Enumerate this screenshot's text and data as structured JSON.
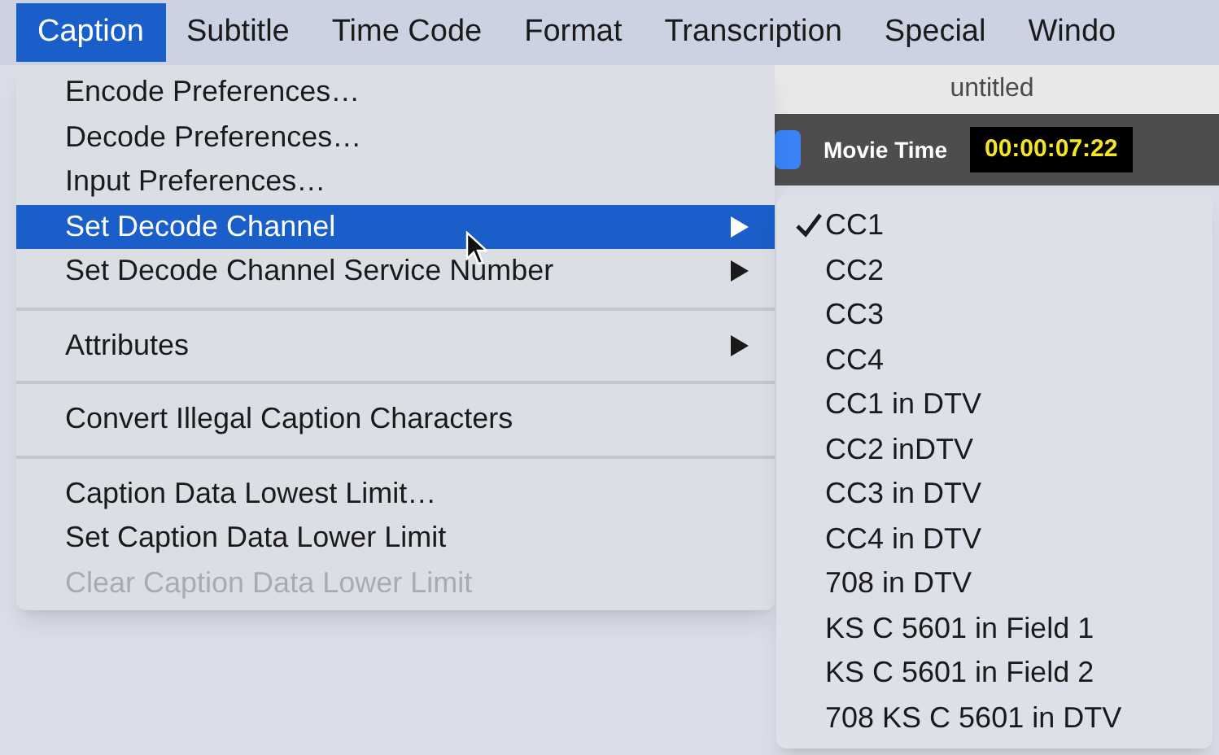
{
  "menu_bar": [
    {
      "label": "Caption",
      "selected": true
    },
    {
      "label": "Subtitle",
      "selected": false
    },
    {
      "label": "Time Code",
      "selected": false
    },
    {
      "label": "Format",
      "selected": false
    },
    {
      "label": "Transcription",
      "selected": false
    },
    {
      "label": "Special",
      "selected": false
    },
    {
      "label": "Windo",
      "selected": false
    }
  ],
  "window": {
    "title": "untitled",
    "movie_time_label": "Movie Time",
    "movie_time": "00:00:07:22"
  },
  "caption_menu": [
    {
      "kind": "item",
      "label": "Encode Preferences…",
      "selected": false,
      "disabled": false,
      "submenu": false
    },
    {
      "kind": "item",
      "label": "Decode Preferences…",
      "selected": false,
      "disabled": false,
      "submenu": false
    },
    {
      "kind": "item",
      "label": "Input Preferences…",
      "selected": false,
      "disabled": false,
      "submenu": false
    },
    {
      "kind": "item",
      "label": "Set Decode Channel",
      "selected": true,
      "disabled": false,
      "submenu": true
    },
    {
      "kind": "item",
      "label": "Set Decode Channel Service Number",
      "selected": false,
      "disabled": false,
      "submenu": true
    },
    {
      "kind": "separator"
    },
    {
      "kind": "item",
      "label": "Attributes",
      "selected": false,
      "disabled": false,
      "submenu": true
    },
    {
      "kind": "separator"
    },
    {
      "kind": "item",
      "label": "Convert Illegal Caption Characters",
      "selected": false,
      "disabled": false,
      "submenu": false
    },
    {
      "kind": "separator"
    },
    {
      "kind": "item",
      "label": "Caption Data Lowest Limit…",
      "selected": false,
      "disabled": false,
      "submenu": false
    },
    {
      "kind": "item",
      "label": "Set Caption Data Lower Limit",
      "selected": false,
      "disabled": false,
      "submenu": false
    },
    {
      "kind": "item",
      "label": "Clear Caption Data Lower Limit",
      "selected": false,
      "disabled": true,
      "submenu": false
    }
  ],
  "decode_channel_submenu": [
    {
      "label": "CC1",
      "checked": true
    },
    {
      "label": "CC2",
      "checked": false
    },
    {
      "label": "CC3",
      "checked": false
    },
    {
      "label": "CC4",
      "checked": false
    },
    {
      "label": "CC1 in DTV",
      "checked": false
    },
    {
      "label": "CC2 inDTV",
      "checked": false
    },
    {
      "label": "CC3 in DTV",
      "checked": false
    },
    {
      "label": "CC4 in DTV",
      "checked": false
    },
    {
      "label": "708 in DTV",
      "checked": false
    },
    {
      "label": "KS C 5601 in Field 1",
      "checked": false
    },
    {
      "label": "KS C 5601 in Field 2",
      "checked": false
    },
    {
      "label": "708 KS C 5601 in DTV",
      "checked": false
    }
  ]
}
